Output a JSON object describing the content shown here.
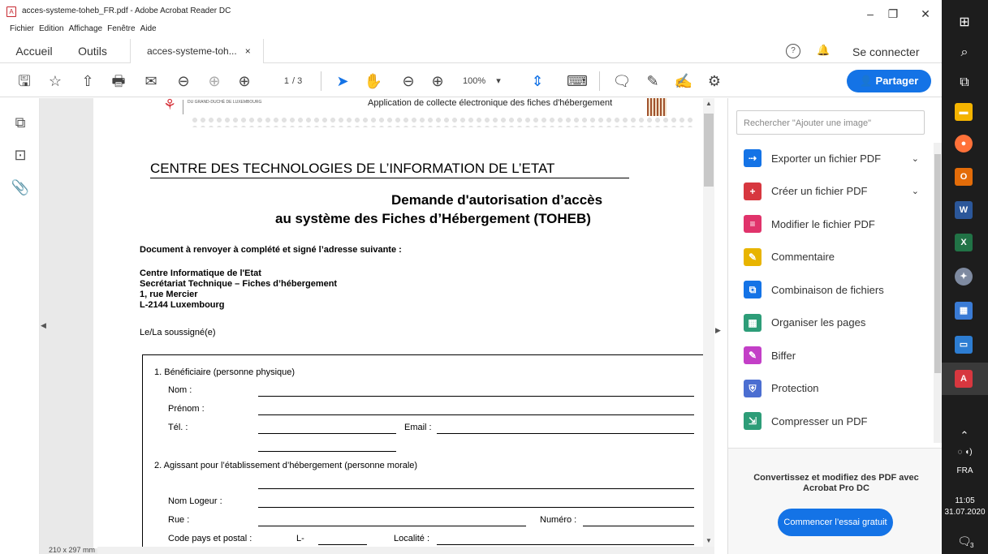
{
  "window": {
    "title": "acces-systeme-toheb_FR.pdf - Adobe Acrobat Reader DC",
    "app_icon_label": "A",
    "minimize": "–",
    "maximize": "❐",
    "close": "✕"
  },
  "menu": [
    "Fichier",
    "Edition",
    "Affichage",
    "Fenêtre",
    "Aide"
  ],
  "tabs": {
    "home": "Accueil",
    "tools": "Outils",
    "document": "acces-systeme-toh...",
    "document_close": "×"
  },
  "header_right": {
    "help": "?",
    "bell": "🔔",
    "sign_in": "Se connecter"
  },
  "toolbar": {
    "current_page": "1",
    "total_pages": "/ 3",
    "zoom": "100%",
    "zoom_caret": "▾",
    "share_label": "Partager",
    "share_icon": "👤"
  },
  "icons": {
    "save": "🖫",
    "bookmark_star": "☆",
    "upload": "⇧",
    "print": "🖶",
    "email": "✉",
    "zoom_out_search": "⊖",
    "prev_page": "⊕",
    "next_page": "⊕",
    "select": "➤",
    "hand": "✋",
    "zoom_out": "⊖",
    "zoom_in": "⊕",
    "fit": "⇕",
    "keyboard": "⌨",
    "comment": "🗨",
    "pen": "✎",
    "sign": "✍",
    "more": "⚙"
  },
  "left_rail_icons": {
    "pages": "⧉",
    "bookmarks": "⊡",
    "attachments": "📎"
  },
  "document": {
    "header_small": "DU GRAND-DUCHÉ DE LUXEMBOURG",
    "header_app": "Application de collecte électronique des fiches d'hébergement",
    "org": "CENTRE DES TECHNOLOGIES DE L’INFORMATION DE L’ETAT",
    "title_line1": "Demande d'autorisation d’accès",
    "title_line2": "au système des Fiches d’Hébergement (TOHEB)",
    "send_to": "Document à renvoyer à complété et signé l’adresse suivante :",
    "addr1": "Centre Informatique de l'Etat",
    "addr2": "Secrétariat Technique – Fiches d’hébergement",
    "addr3": "1, rue Mercier",
    "addr4": "L-2144 Luxembourg",
    "undersigned": "Le/La  soussigné(e)",
    "s1": "1. Bénéficiaire (personne physique)",
    "nom": "Nom :",
    "prenom": "Prénom :",
    "tel": "Tél. :",
    "email": "Email :",
    "s2": "2.  Agissant pour l’établissement d’hébergement (personne morale)",
    "nom_logeur": "Nom Logeur :",
    "rue": "Rue :",
    "numero": "Numéro :",
    "code": "Code pays et postal :",
    "l": "L-",
    "localite": "Localité :",
    "page_size": "210 x 297 mm"
  },
  "right_panel": {
    "search_placeholder": "Rechercher \"Ajouter une image\"",
    "tools": [
      {
        "label": "Exporter un fichier PDF",
        "color": "#1473e6",
        "glyph": "⇢"
      },
      {
        "label": "Créer un fichier PDF",
        "color": "#d7373f",
        "glyph": "+"
      },
      {
        "label": "Modifier le fichier PDF",
        "color": "#e0336b",
        "glyph": "≡"
      },
      {
        "label": "Commentaire",
        "color": "#e8b400",
        "glyph": "✎"
      },
      {
        "label": "Combinaison de fichiers",
        "color": "#1473e6",
        "glyph": "⧉"
      },
      {
        "label": "Organiser les pages",
        "color": "#2d9d78",
        "glyph": "▦"
      },
      {
        "label": "Biffer",
        "color": "#c33fc7",
        "glyph": "✎"
      },
      {
        "label": "Protection",
        "color": "#4b6ed1",
        "glyph": "⛨"
      },
      {
        "label": "Compresser un PDF",
        "color": "#2d9d78",
        "glyph": "⇲"
      }
    ],
    "chevron": "⌄",
    "promo": "Convertissez et modifiez des PDF avec Acrobat Pro DC",
    "trial_button": "Commencer l’essai gratuit"
  },
  "taskbar": {
    "lang": "FRA",
    "time": "11:05",
    "date": "31.07.2020",
    "tray": "⌃",
    "notif": "3"
  }
}
